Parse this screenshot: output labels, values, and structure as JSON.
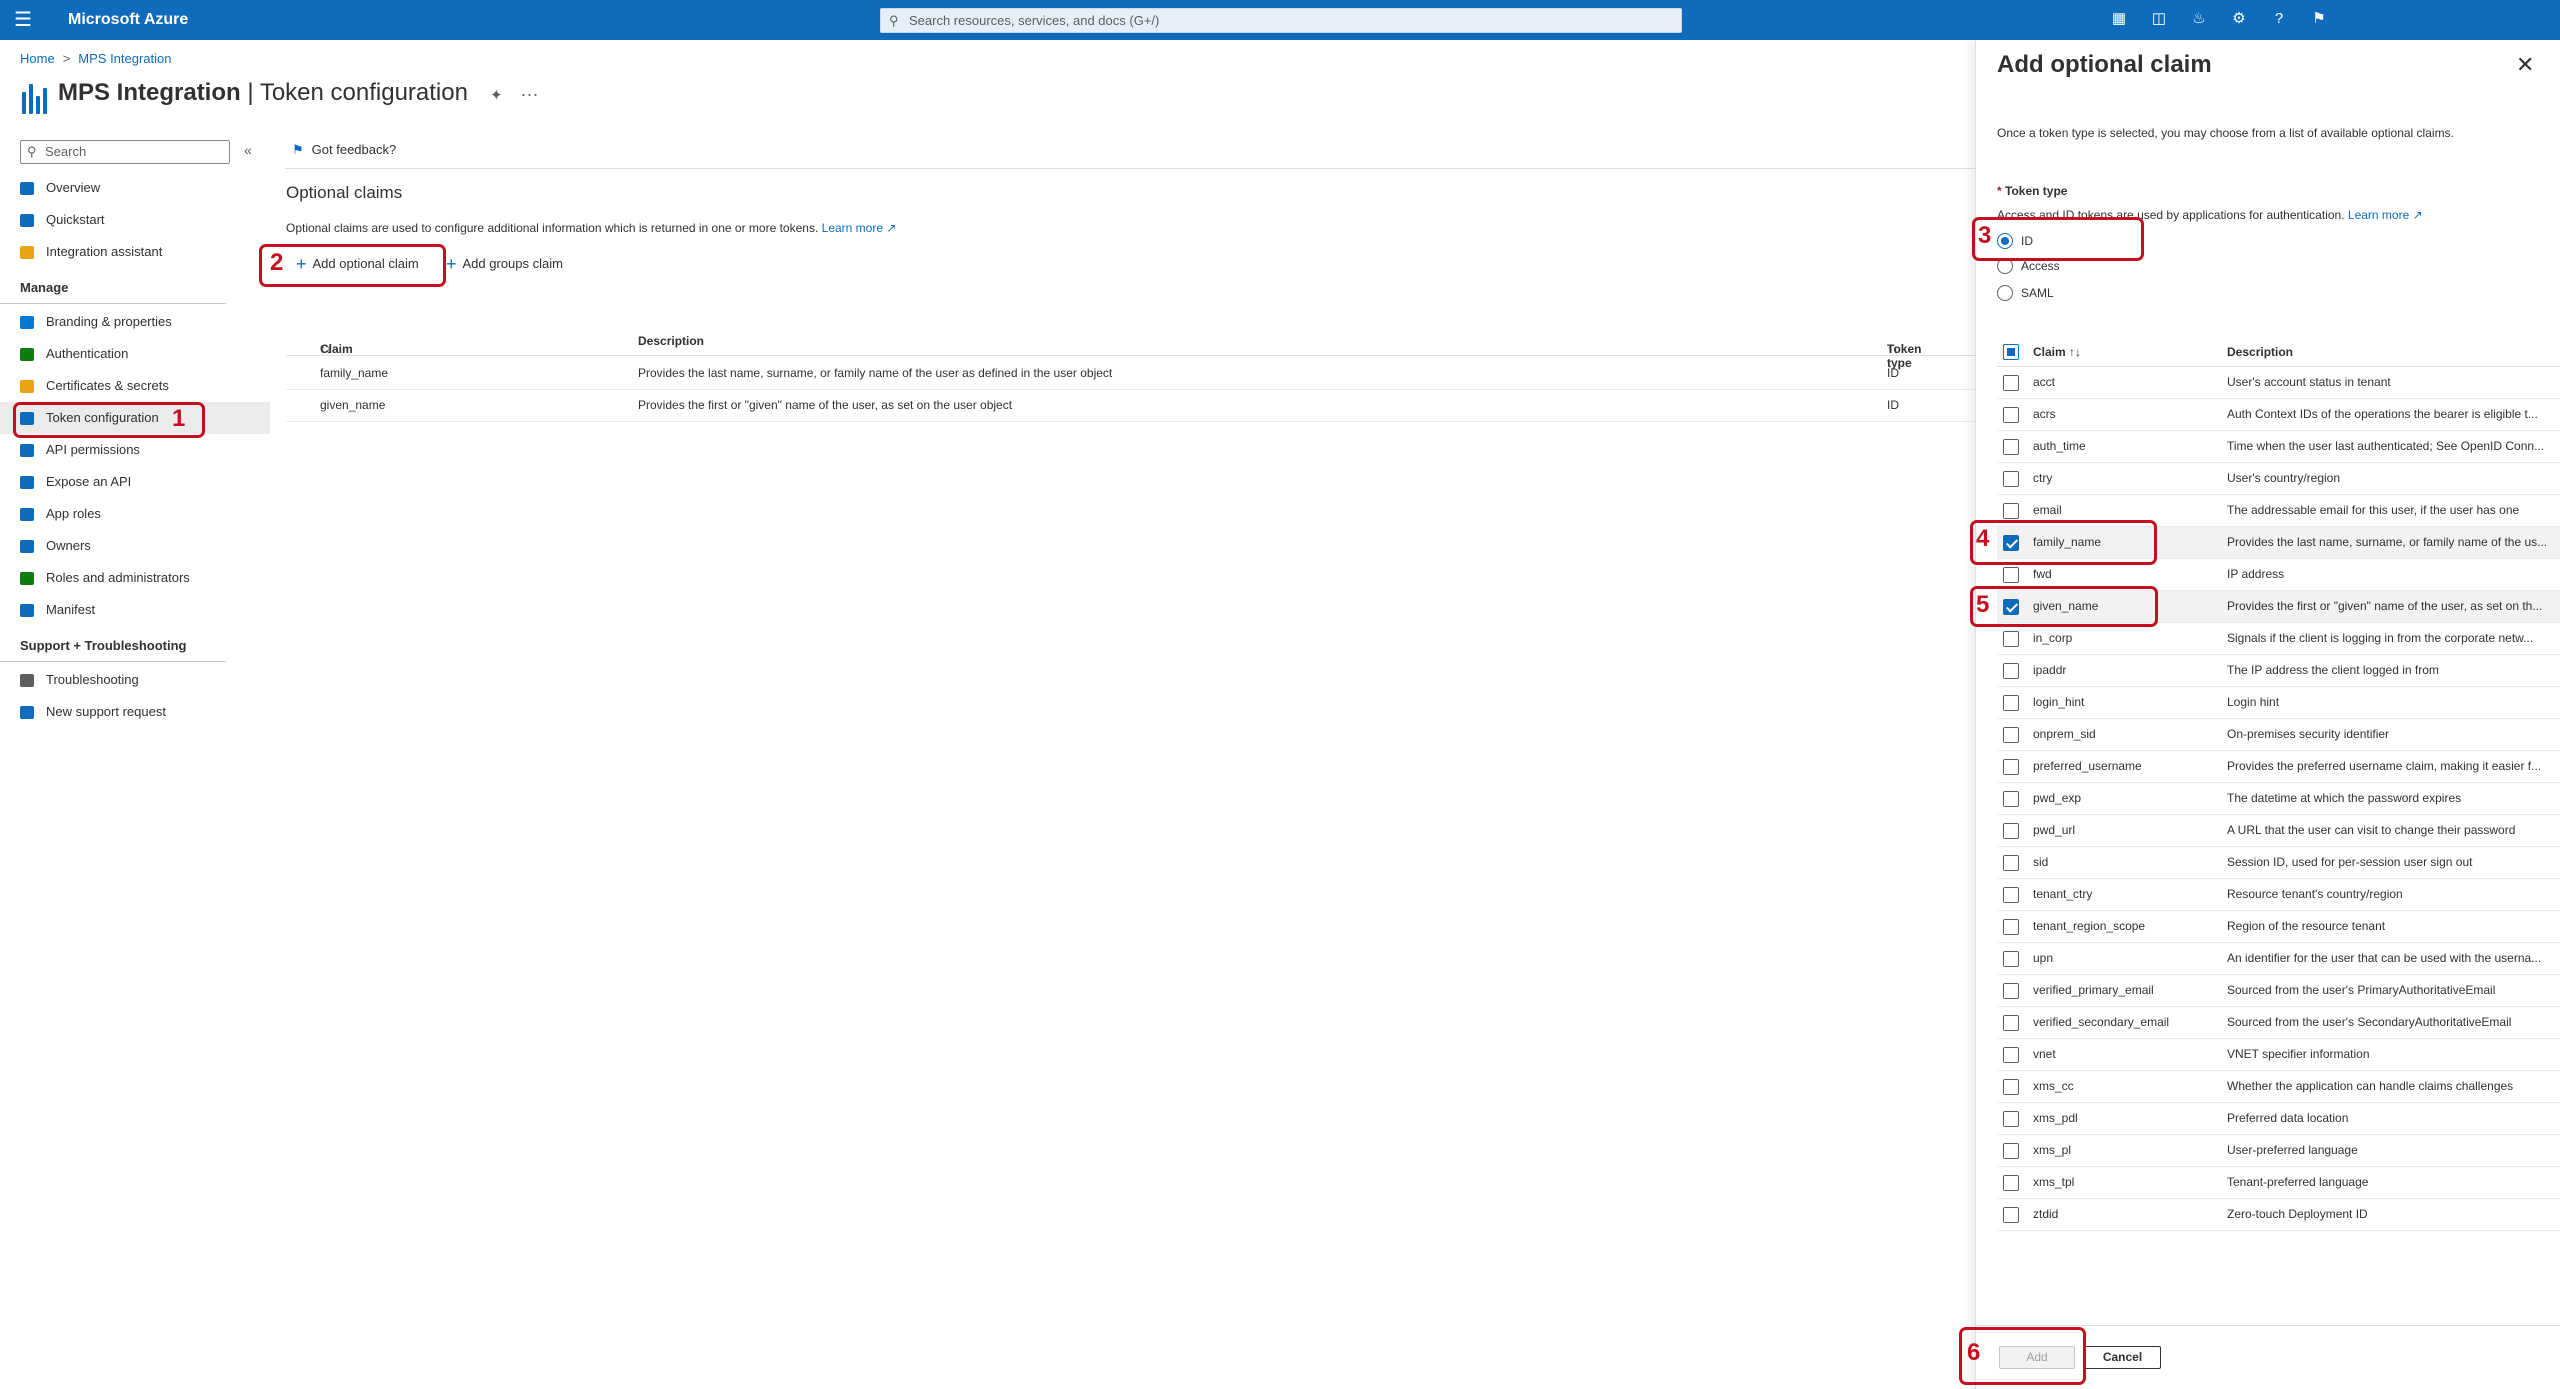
{
  "topbar": {
    "brand": "Microsoft Azure",
    "search_placeholder": "Search resources, services, and docs (G+/)"
  },
  "breadcrumb": [
    "Home",
    "MPS Integration"
  ],
  "title": {
    "app": "MPS Integration",
    "page": "Token configuration"
  },
  "sidebar": {
    "search": "Search",
    "items": [
      {
        "label": "Overview",
        "color": "#0f6cbd"
      },
      {
        "label": "Quickstart",
        "color": "#0f6cbd"
      },
      {
        "label": "Integration assistant",
        "color": "#e8a317"
      }
    ],
    "manage_header": "Manage",
    "manage_items": [
      {
        "label": "Branding & properties",
        "color": "#0078d4"
      },
      {
        "label": "Authentication",
        "color": "#107c10"
      },
      {
        "label": "Certificates & secrets",
        "color": "#e8a317"
      },
      {
        "label": "Token configuration",
        "color": "#0f6cbd"
      },
      {
        "label": "API permissions",
        "color": "#0f6cbd"
      },
      {
        "label": "Expose an API",
        "color": "#0f6cbd"
      },
      {
        "label": "App roles",
        "color": "#0f6cbd"
      },
      {
        "label": "Owners",
        "color": "#0f6cbd"
      },
      {
        "label": "Roles and administrators",
        "color": "#107c10"
      },
      {
        "label": "Manifest",
        "color": "#0f6cbd"
      }
    ],
    "support_header": "Support + Troubleshooting",
    "support_items": [
      {
        "label": "Troubleshooting",
        "color": "#605e5c"
      },
      {
        "label": "New support request",
        "color": "#0f6cbd"
      }
    ]
  },
  "main": {
    "feedback": "Got feedback?",
    "section_title": "Optional claims",
    "section_desc": "Optional claims are used to configure additional information which is returned in one or more tokens.",
    "learn_more": "Learn more",
    "add_optional_claim": "Add optional claim",
    "add_groups_claim": "Add groups claim",
    "columns": [
      "Claim",
      "Description",
      "Token type"
    ],
    "rows": [
      {
        "claim": "family_name",
        "description": "Provides the last name, surname, or family name of the user as defined in the user object",
        "token": "ID"
      },
      {
        "claim": "given_name",
        "description": "Provides the first or \"given\" name of the user, as set on the user object",
        "token": "ID"
      }
    ]
  },
  "panel": {
    "title": "Add optional claim",
    "intro": "Once a token type is selected, you may choose from a list of available optional claims.",
    "token_type_label": "Token type",
    "token_type_desc": "Access and ID tokens are used by applications for authentication.",
    "learn_more": "Learn more",
    "token_types": [
      "ID",
      "Access",
      "SAML"
    ],
    "selected_token_type": "ID",
    "columns": [
      "Claim",
      "Description"
    ],
    "claims": [
      {
        "name": "acct",
        "desc": "User's account status in tenant",
        "checked": false
      },
      {
        "name": "acrs",
        "desc": "Auth Context IDs of the operations the bearer is eligible t...",
        "checked": false
      },
      {
        "name": "auth_time",
        "desc": "Time when the user last authenticated; See OpenID Conn...",
        "checked": false
      },
      {
        "name": "ctry",
        "desc": "User's country/region",
        "checked": false
      },
      {
        "name": "email",
        "desc": "The addressable email for this user, if the user has one",
        "checked": false
      },
      {
        "name": "family_name",
        "desc": "Provides the last name, surname, or family name of the us...",
        "checked": true
      },
      {
        "name": "fwd",
        "desc": "IP address",
        "checked": false
      },
      {
        "name": "given_name",
        "desc": "Provides the first or \"given\" name of the user, as set on th...",
        "checked": true
      },
      {
        "name": "in_corp",
        "desc": "Signals if the client is logging in from the corporate netw...",
        "checked": false
      },
      {
        "name": "ipaddr",
        "desc": "The IP address the client logged in from",
        "checked": false
      },
      {
        "name": "login_hint",
        "desc": "Login hint",
        "checked": false
      },
      {
        "name": "onprem_sid",
        "desc": "On-premises security identifier",
        "checked": false
      },
      {
        "name": "preferred_username",
        "desc": "Provides the preferred username claim, making it easier f...",
        "checked": false
      },
      {
        "name": "pwd_exp",
        "desc": "The datetime at which the password expires",
        "checked": false
      },
      {
        "name": "pwd_url",
        "desc": "A URL that the user can visit to change their password",
        "checked": false
      },
      {
        "name": "sid",
        "desc": "Session ID, used for per-session user sign out",
        "checked": false
      },
      {
        "name": "tenant_ctry",
        "desc": "Resource tenant's country/region",
        "checked": false
      },
      {
        "name": "tenant_region_scope",
        "desc": "Region of the resource tenant",
        "checked": false
      },
      {
        "name": "upn",
        "desc": "An identifier for the user that can be used with the userna...",
        "checked": false
      },
      {
        "name": "verified_primary_email",
        "desc": "Sourced from the user's PrimaryAuthoritativeEmail",
        "checked": false
      },
      {
        "name": "verified_secondary_email",
        "desc": "Sourced from the user's SecondaryAuthoritativeEmail",
        "checked": false
      },
      {
        "name": "vnet",
        "desc": "VNET specifier information",
        "checked": false
      },
      {
        "name": "xms_cc",
        "desc": "Whether the application can handle claims challenges",
        "checked": false
      },
      {
        "name": "xms_pdl",
        "desc": "Preferred data location",
        "checked": false
      },
      {
        "name": "xms_pl",
        "desc": "User-preferred language",
        "checked": false
      },
      {
        "name": "xms_tpl",
        "desc": "Tenant-preferred language",
        "checked": false
      },
      {
        "name": "ztdid",
        "desc": "Zero-touch Deployment ID",
        "checked": false
      }
    ],
    "add_button": "Add",
    "cancel_button": "Cancel"
  },
  "annotations": [
    "1",
    "2",
    "3",
    "4",
    "5",
    "6"
  ]
}
